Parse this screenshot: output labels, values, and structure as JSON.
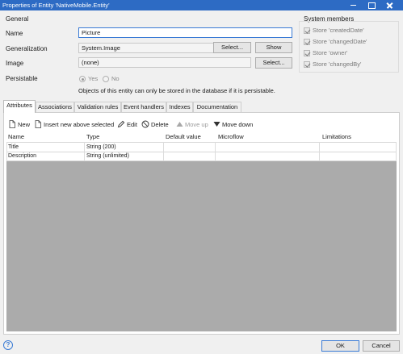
{
  "window": {
    "title": "Properties of Entity 'NativeMobile.Entity'"
  },
  "general": {
    "group_label": "General",
    "name_label": "Name",
    "name_value": "Picture",
    "generalization_label": "Generalization",
    "generalization_value": "System.Image",
    "generalization_select": "Select...",
    "generalization_show": "Show",
    "image_label": "Image",
    "image_value": "(none)",
    "image_select": "Select...",
    "persistable_label": "Persistable",
    "persistable_yes": "Yes",
    "persistable_no": "No",
    "persistable_selected": "Yes",
    "persistable_note": "Objects of this entity can only be stored in the database if it is persistable."
  },
  "system_members": {
    "group_label": "System members",
    "items": [
      {
        "label": "Store 'createdDate'",
        "checked": true
      },
      {
        "label": "Store 'changedDate'",
        "checked": true
      },
      {
        "label": "Store 'owner'",
        "checked": true
      },
      {
        "label": "Store 'changedBy'",
        "checked": true
      }
    ]
  },
  "tabs": [
    {
      "label": "Attributes",
      "active": true
    },
    {
      "label": "Associations",
      "active": false
    },
    {
      "label": "Validation rules",
      "active": false
    },
    {
      "label": "Event handlers",
      "active": false
    },
    {
      "label": "Indexes",
      "active": false
    },
    {
      "label": "Documentation",
      "active": false
    }
  ],
  "toolbar": {
    "new": "New",
    "insert": "Insert new above selected",
    "edit": "Edit",
    "delete": "Delete",
    "move_up": "Move up",
    "move_down": "Move down"
  },
  "attributes_grid": {
    "columns": [
      "Name",
      "Type",
      "Default value",
      "Microflow",
      "Limitations"
    ],
    "rows": [
      [
        "Title",
        "String (200)",
        "",
        "",
        ""
      ],
      [
        "Description",
        "String (unlimited)",
        "",
        "",
        ""
      ]
    ]
  },
  "footer": {
    "help_icon": "question-circle-icon",
    "ok": "OK",
    "cancel": "Cancel"
  },
  "colors": {
    "titlebar": "#2d6bc4",
    "accent": "#3a7bd5",
    "grid_empty": "#ababab"
  }
}
